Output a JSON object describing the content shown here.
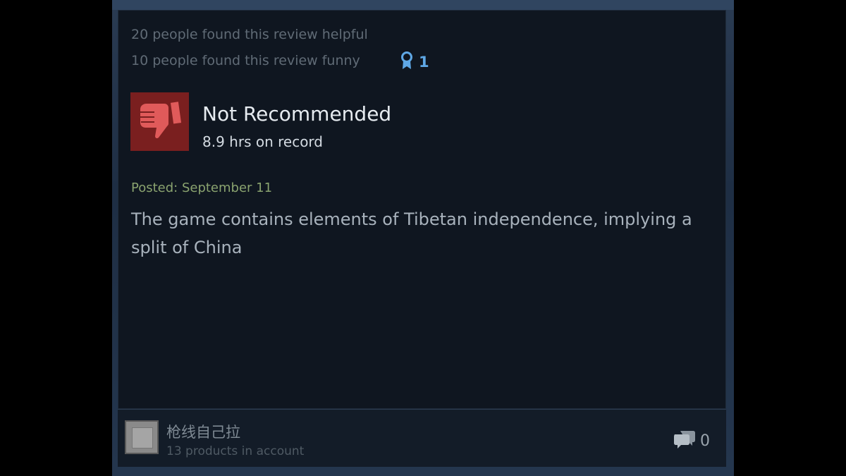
{
  "review": {
    "helpful_text": "20 people found this review helpful",
    "funny_text": "10 people found this review funny",
    "award_count": "1",
    "verdict": "Not Recommended",
    "hours": "8.9 hrs on record",
    "posted": "Posted: September 11",
    "body": "The game contains elements of Tibetan independence, implying a split of China"
  },
  "author": {
    "username": "枪线自己拉",
    "products": "13 products in account"
  },
  "footer": {
    "comment_count": "0"
  },
  "icons": {
    "thumb": "thumbs-down-icon",
    "award": "award-ribbon-icon",
    "comment": "comment-bubbles-icon"
  },
  "colors": {
    "thumb_bg": "#7a1f1f",
    "thumb_fg": "#e05a5a",
    "award": "#5fa8e6",
    "posted": "#8aa36f",
    "card_bg": "#0f1620"
  }
}
